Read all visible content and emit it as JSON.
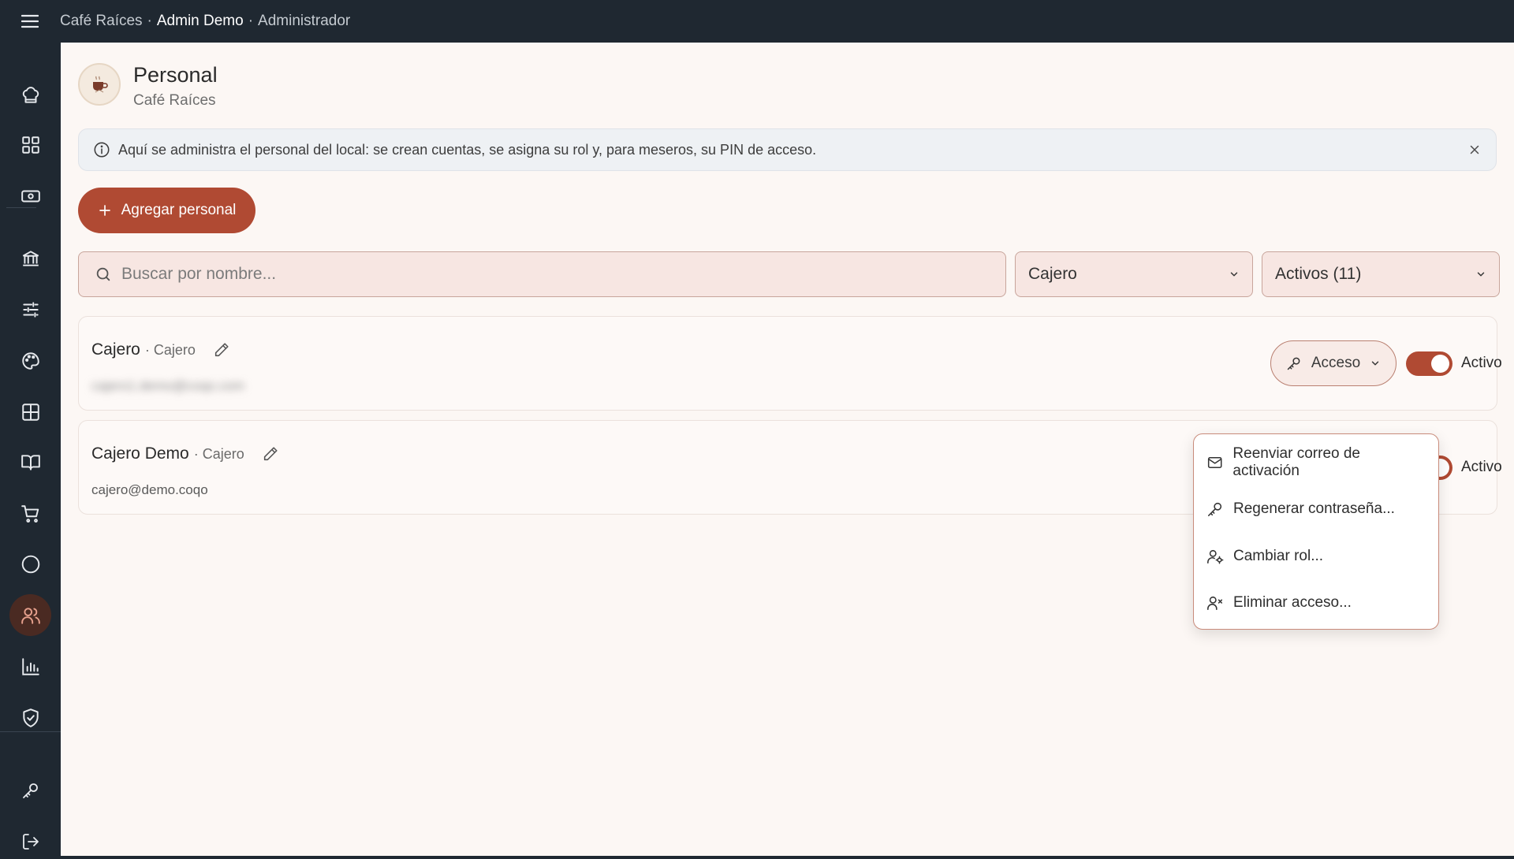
{
  "header": {
    "restaurant": "Café Raíces",
    "user": "Admin Demo",
    "role": "Administrador",
    "separator": "·"
  },
  "sidebar": {
    "items": [
      {
        "name": "chef-hat-icon"
      },
      {
        "name": "grid-icon"
      },
      {
        "name": "cash-icon"
      },
      {
        "name": "bank-icon"
      },
      {
        "name": "sliders-icon"
      },
      {
        "name": "palette-icon"
      },
      {
        "name": "table-icon"
      },
      {
        "name": "book-icon"
      },
      {
        "name": "cart-icon"
      },
      {
        "name": "circle-icon"
      },
      {
        "name": "users-icon",
        "active": true
      },
      {
        "name": "chart-icon"
      },
      {
        "name": "shield-icon"
      },
      {
        "name": "key-icon"
      },
      {
        "name": "logout-icon"
      }
    ]
  },
  "page": {
    "title": "Personal",
    "subtitle": "Café Raíces"
  },
  "info": {
    "text": "Aquí se administra el personal del local: se crean cuentas, se asigna su rol y, para meseros, su PIN de acceso."
  },
  "actions": {
    "add_label": "Agregar personal"
  },
  "filters": {
    "search_placeholder": "Buscar por nombre...",
    "role_selected": "Cajero",
    "status_selected": "Activos (11)"
  },
  "staff": [
    {
      "name": "Cajero",
      "role": "Cajero",
      "email": "cajero1.demo@coqo.com",
      "email_hidden": true,
      "status": "Activo"
    },
    {
      "name": "Cajero Demo",
      "role": "Cajero",
      "email": "cajero@demo.coqo",
      "status": "Activo"
    }
  ],
  "access": {
    "label": "Acceso",
    "menu": [
      {
        "label": "Reenviar correo de activación",
        "icon": "mail-icon"
      },
      {
        "label": "Regenerar contraseña...",
        "icon": "key-icon"
      },
      {
        "label": "Cambiar rol...",
        "icon": "user-gear-icon"
      },
      {
        "label": "Eliminar acceso...",
        "icon": "user-x-icon"
      }
    ]
  },
  "colors": {
    "accent": "#b04a33",
    "sidebar": "#1f2831",
    "background": "#fcf7f4"
  }
}
